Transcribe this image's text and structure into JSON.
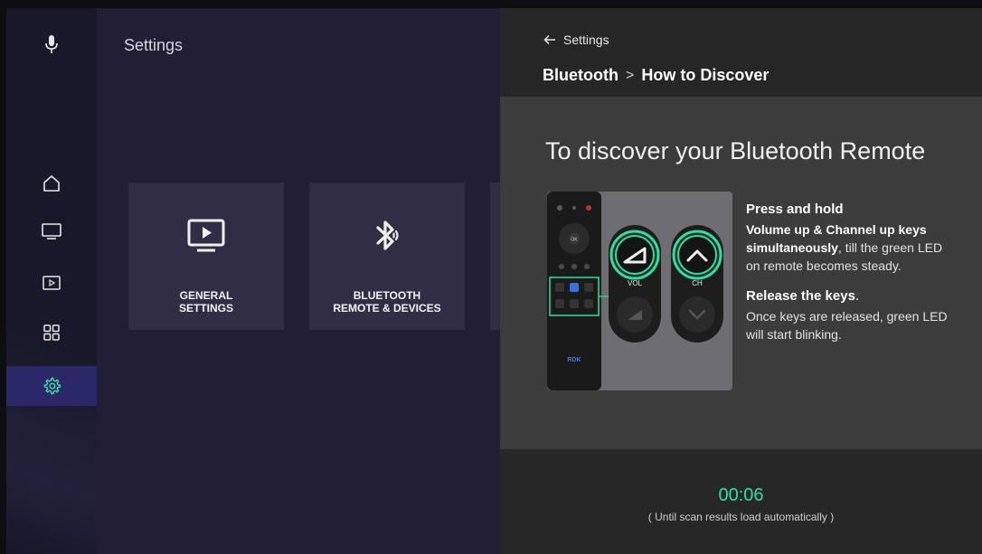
{
  "home": {
    "title": "Settings",
    "tiles": [
      {
        "label_line1": "GENERAL",
        "label_line2": "SETTINGS",
        "icon": "tv-play-icon"
      },
      {
        "label_line1": "BLUETOOTH",
        "label_line2": "REMOTE & DEVICES",
        "icon": "bluetooth-icon"
      }
    ]
  },
  "nav": {
    "items": [
      "mic-icon",
      "home-icon",
      "tv-icon",
      "media-icon",
      "apps-grid-icon",
      "gear-icon"
    ],
    "active": "gear-icon"
  },
  "panel": {
    "back_label": "Settings",
    "breadcrumb": [
      "Bluetooth",
      "How to Discover"
    ],
    "breadcrumb_sep": ">",
    "heading": "To discover your Bluetooth Remote",
    "remote_labels": {
      "vol": "VOL",
      "ch": "CH",
      "brand": "RDK",
      "ok": "OK"
    },
    "step1_title": "Press and hold",
    "step1_bold": "Volume up & Channel up keys simultaneously",
    "step1_rest": ", till the green LED on remote becomes steady.",
    "step2_title": "Release the keys",
    "step2_title_suffix": ".",
    "step2_text": "Once keys are released, green LED will start blinking.",
    "timer": "00:06",
    "timer_note": "( Until scan results load automatically )"
  },
  "colors": {
    "accent": "#2ee0a0",
    "rail_active": "#2b2869",
    "background": "#211e35"
  }
}
